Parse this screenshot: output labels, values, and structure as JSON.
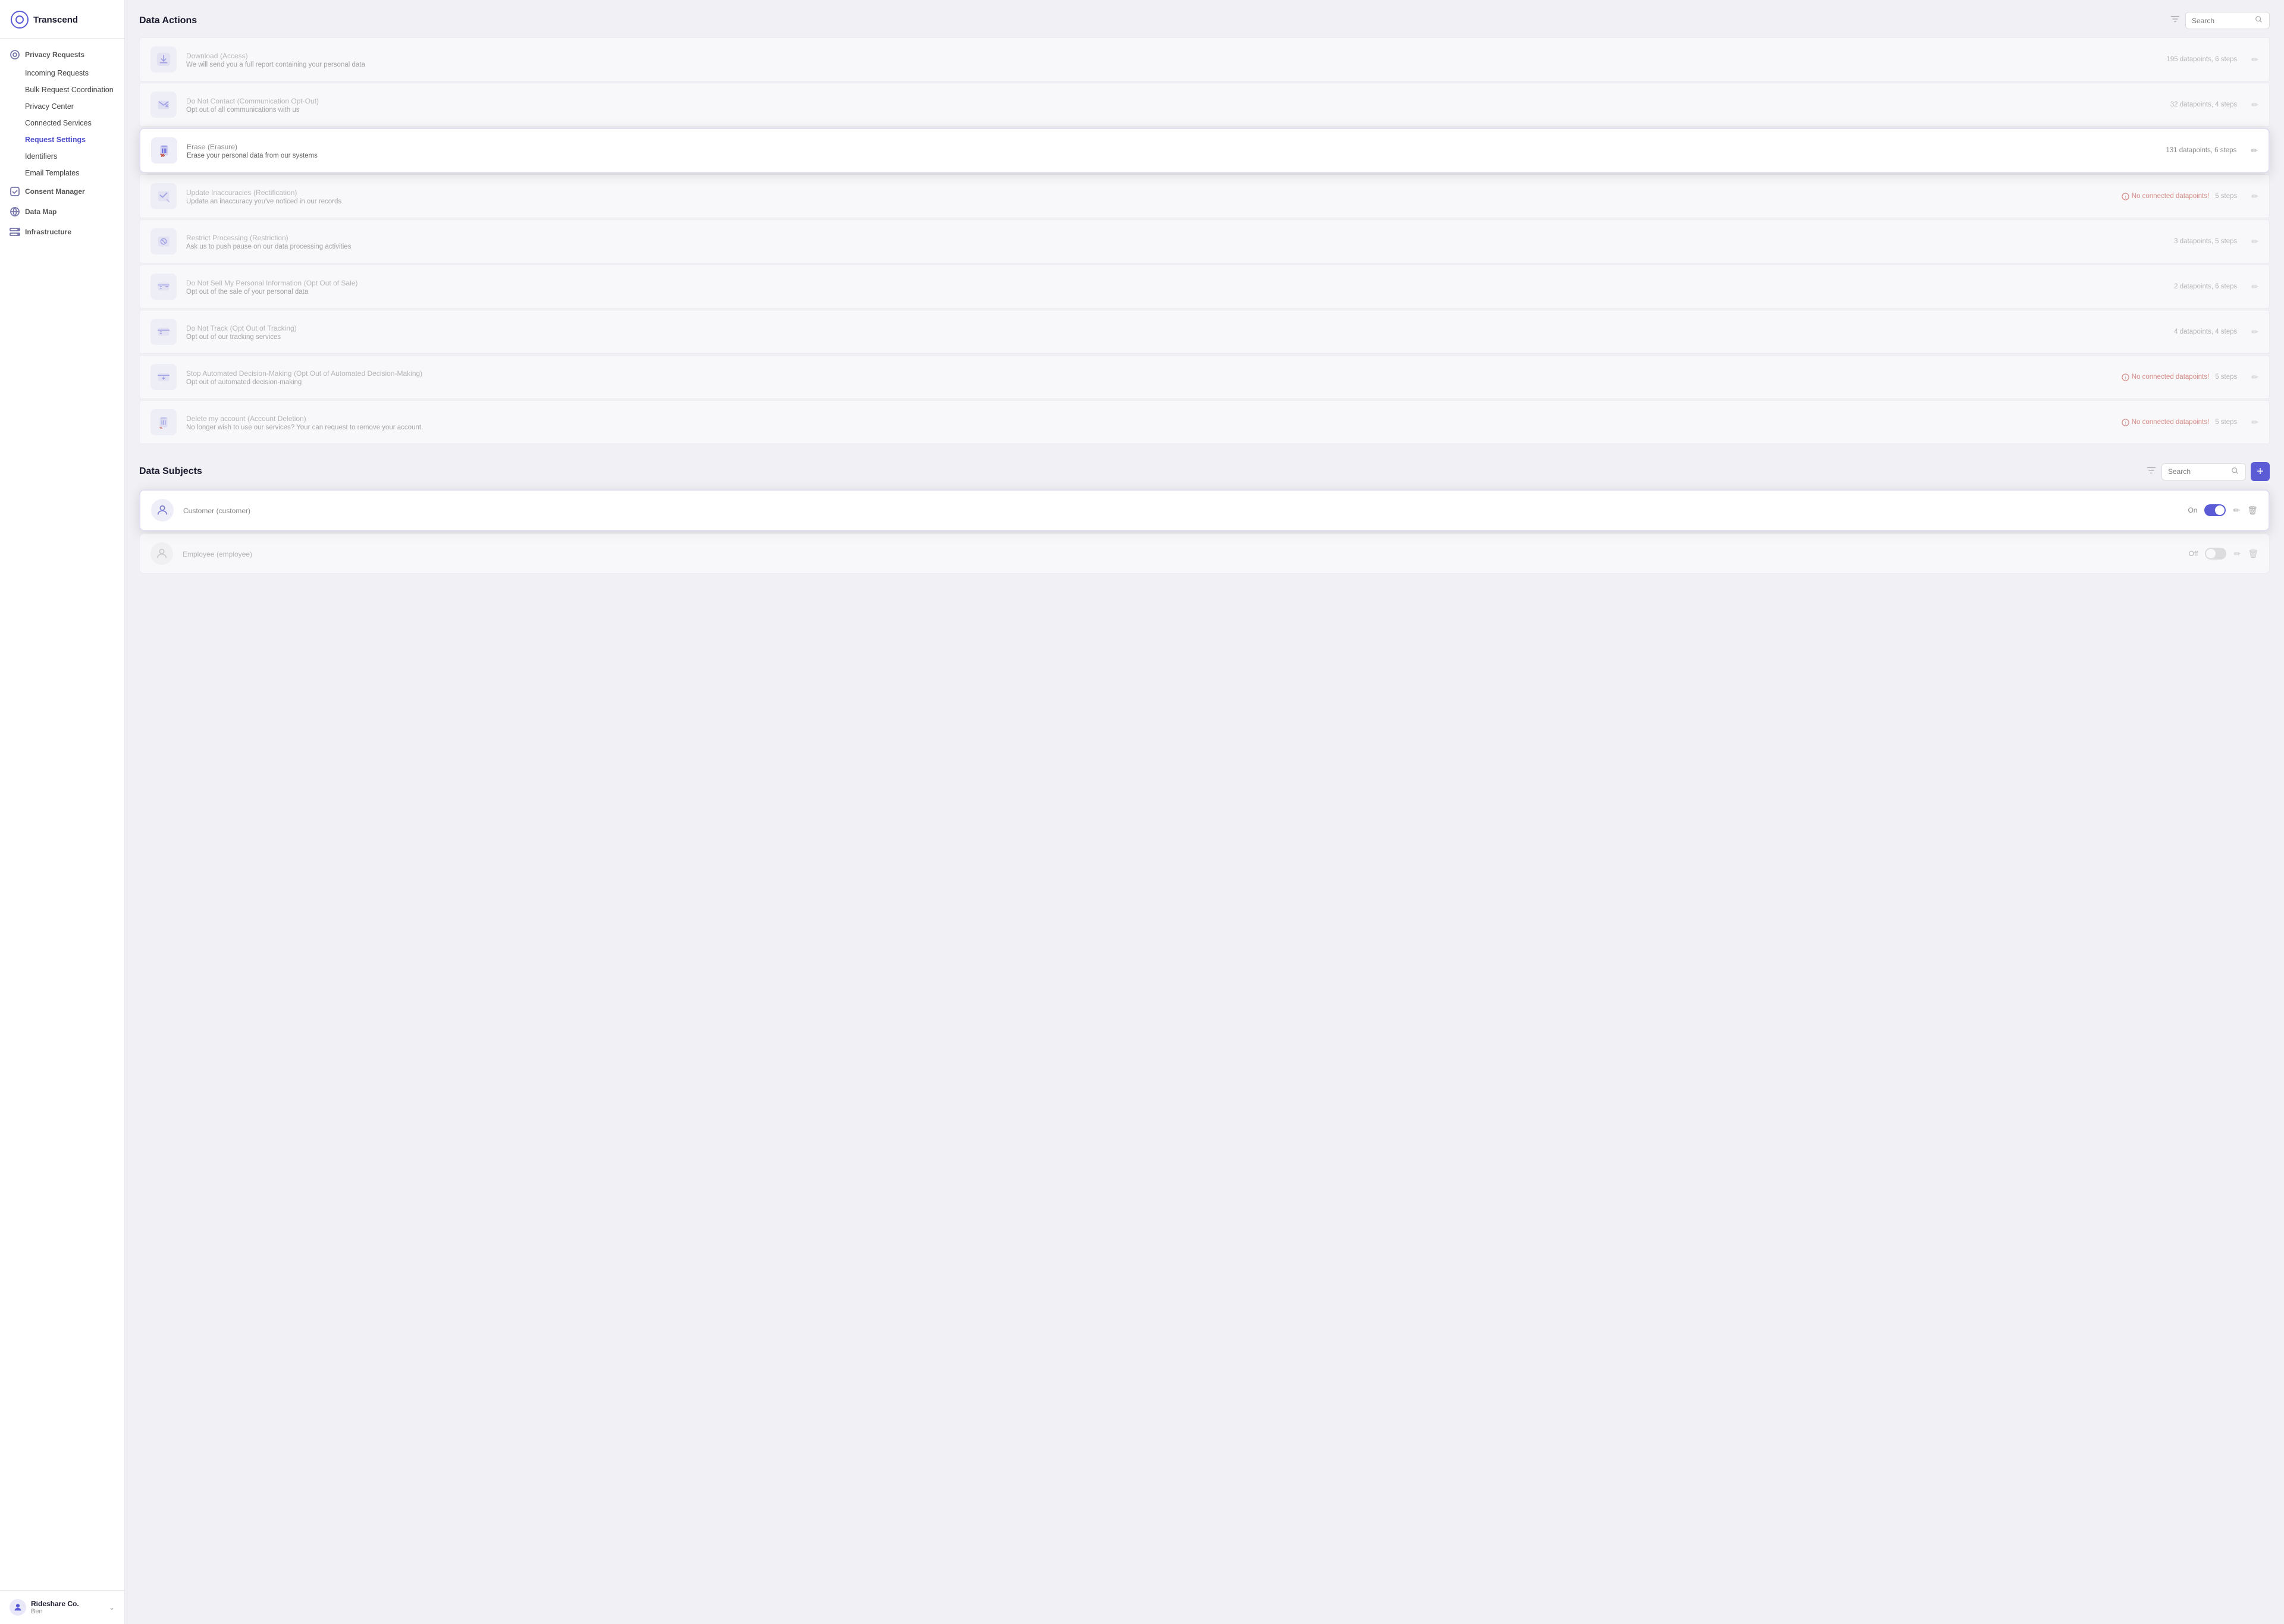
{
  "app": {
    "name": "Transcend"
  },
  "sidebar": {
    "groups": [
      {
        "id": "privacy-requests",
        "icon": "circle-icon",
        "label": "Privacy Requests",
        "items": [
          {
            "id": "incoming-requests",
            "label": "Incoming Requests",
            "active": false
          },
          {
            "id": "bulk-request-coordination",
            "label": "Bulk Request Coordination",
            "active": false
          },
          {
            "id": "privacy-center",
            "label": "Privacy Center",
            "active": false
          },
          {
            "id": "connected-services",
            "label": "Connected Services",
            "active": false
          },
          {
            "id": "request-settings",
            "label": "Request Settings",
            "active": true
          },
          {
            "id": "identifiers",
            "label": "Identifiers",
            "active": false
          },
          {
            "id": "email-templates",
            "label": "Email Templates",
            "active": false
          }
        ]
      },
      {
        "id": "consent-manager",
        "icon": "consent-icon",
        "label": "Consent Manager",
        "items": []
      },
      {
        "id": "data-map",
        "icon": "map-icon",
        "label": "Data Map",
        "items": []
      },
      {
        "id": "infrastructure",
        "icon": "infra-icon",
        "label": "Infrastructure",
        "items": []
      }
    ],
    "footer": {
      "company": "Rideshare Co.",
      "user": "Ben"
    }
  },
  "main": {
    "dataActions": {
      "title": "Data Actions",
      "search_placeholder": "Search",
      "items": [
        {
          "id": "download",
          "icon": "download-icon",
          "title": "Download",
          "subtitle": "(Access)",
          "description": "We will send you a full report containing your personal data",
          "meta": "195 datapoints,  6 steps",
          "noData": false,
          "highlighted": false
        },
        {
          "id": "do-not-contact",
          "icon": "do-not-contact-icon",
          "title": "Do Not Contact",
          "subtitle": "(Communication Opt-Out)",
          "description": "Opt out of all communications with us",
          "meta": "32 datapoints,  4 steps",
          "noData": false,
          "highlighted": false
        },
        {
          "id": "erase",
          "icon": "erase-icon",
          "title": "Erase",
          "subtitle": "(Erasure)",
          "description": "Erase your personal data from our systems",
          "meta": "131 datapoints,  6 steps",
          "noData": false,
          "highlighted": true
        },
        {
          "id": "update-inaccuracies",
          "icon": "update-icon",
          "title": "Update Inaccuracies",
          "subtitle": "(Rectification)",
          "description": "Update an inaccuracy you've noticed in our records",
          "meta": " 5 steps",
          "noData": true,
          "noDataText": "No connected datapoints!",
          "highlighted": false
        },
        {
          "id": "restrict-processing",
          "icon": "restrict-icon",
          "title": "Restrict Processing",
          "subtitle": "(Restriction)",
          "description": "Ask us to push pause on our data processing activities",
          "meta": "3 datapoints,  5 steps",
          "noData": false,
          "highlighted": false
        },
        {
          "id": "do-not-sell",
          "icon": "do-not-sell-icon",
          "title": "Do Not Sell My Personal Information",
          "subtitle": "(Opt Out of Sale)",
          "description": "Opt out of the sale of your personal data",
          "meta": "2 datapoints,  6 steps",
          "noData": false,
          "highlighted": false
        },
        {
          "id": "do-not-track",
          "icon": "do-not-track-icon",
          "title": "Do Not Track",
          "subtitle": "(Opt Out of Tracking)",
          "description": "Opt out of our tracking services",
          "meta": "4 datapoints,  4 steps",
          "noData": false,
          "highlighted": false
        },
        {
          "id": "stop-automated",
          "icon": "stop-automated-icon",
          "title": "Stop Automated Decision-Making",
          "subtitle": "(Opt Out of Automated Decision-Making)",
          "description": "Opt out of automated decision-making",
          "meta": " 5 steps",
          "noData": true,
          "noDataText": "No connected datapoints!",
          "highlighted": false
        },
        {
          "id": "delete-account",
          "icon": "delete-account-icon",
          "title": "Delete my account",
          "subtitle": "(Account Deletion)",
          "description": "No longer wish to use our services? Your can request to remove your account.",
          "meta": " 5 steps",
          "noData": true,
          "noDataText": "No connected datapoints!",
          "highlighted": false
        }
      ]
    },
    "dataSubjects": {
      "title": "Data Subjects",
      "search_placeholder": "Search",
      "add_label": "+",
      "items": [
        {
          "id": "customer",
          "icon": "customer-icon",
          "title": "Customer",
          "subtitle": "(customer)",
          "status": "On",
          "enabled": true,
          "highlighted": true
        },
        {
          "id": "employee",
          "icon": "employee-icon",
          "title": "Employee",
          "subtitle": "(employee)",
          "status": "Off",
          "enabled": false,
          "highlighted": false
        }
      ]
    }
  }
}
